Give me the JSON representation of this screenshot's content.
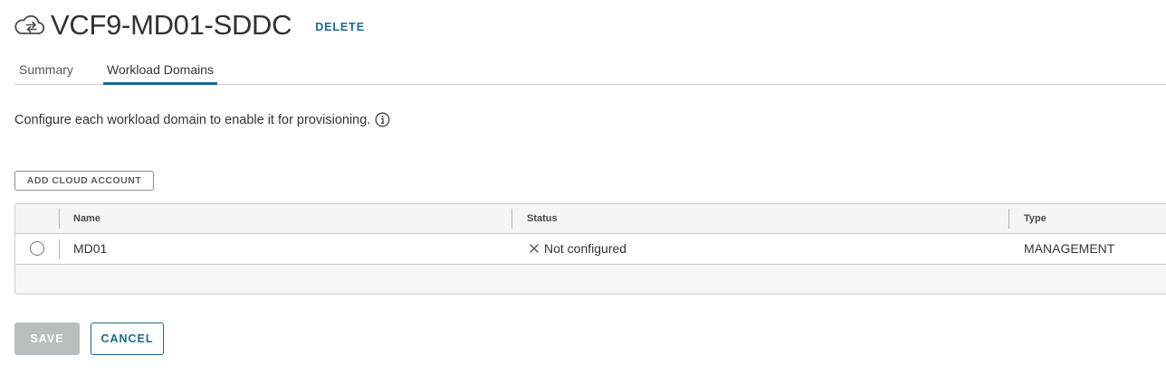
{
  "header": {
    "icon": "cloud-sync-icon",
    "title": "VCF9-MD01-SDDC",
    "delete_label": "DELETE"
  },
  "tabs": [
    {
      "label": "Summary",
      "active": false
    },
    {
      "label": "Workload Domains",
      "active": true
    }
  ],
  "description": {
    "text": "Configure each workload domain to enable it for provisioning.",
    "icon": "info-circle-icon"
  },
  "toolbar": {
    "add_cloud_account_label": "ADD CLOUD ACCOUNT"
  },
  "grid": {
    "columns": [
      "Name",
      "Status",
      "Type"
    ],
    "rows": [
      {
        "selected": false,
        "name": "MD01",
        "status": "Not configured",
        "status_icon": "close-x-icon",
        "type": "MANAGEMENT"
      }
    ]
  },
  "footer": {
    "save_label": "SAVE",
    "save_enabled": false,
    "cancel_label": "CANCEL"
  },
  "colors": {
    "accent": "#1b6a8d",
    "disabled_button": "#b8bdc0"
  }
}
